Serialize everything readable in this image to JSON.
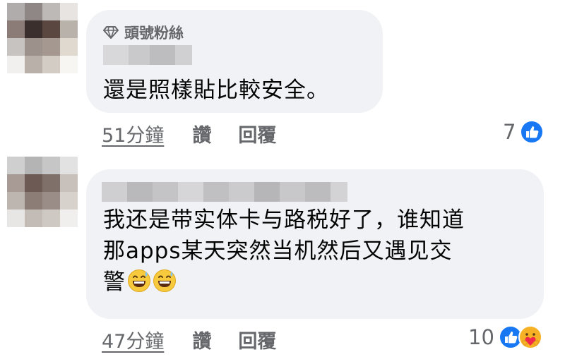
{
  "comments": [
    {
      "badge": {
        "icon": "diamond-icon",
        "label": "頭號粉絲"
      },
      "text_lines": [
        "還是照樣貼比較安全。"
      ],
      "emojis": [],
      "actions": {
        "time": "51分鐘",
        "like": "讚",
        "reply": "回覆"
      },
      "reactions": {
        "count": "7",
        "icons": [
          "like-icon"
        ]
      }
    },
    {
      "text_lines": [
        "我还是带实体卡与路税好了，谁知道",
        "那apps某天突然当机然后又遇见交",
        "警"
      ],
      "emojis": [
        "grinning-sweat-emoji",
        "grinning-sweat-emoji"
      ],
      "actions": {
        "time": "47分鐘",
        "like": "讚",
        "reply": "回覆"
      },
      "reactions": {
        "count": "10",
        "icons": [
          "like-icon",
          "care-icon"
        ]
      }
    }
  ],
  "colors": {
    "bubble_bg": "#f0f2f5",
    "secondary_text": "#65676b",
    "primary_text": "#050505",
    "like_blue": "#1877f2",
    "care_yellow": "#f7b125"
  }
}
